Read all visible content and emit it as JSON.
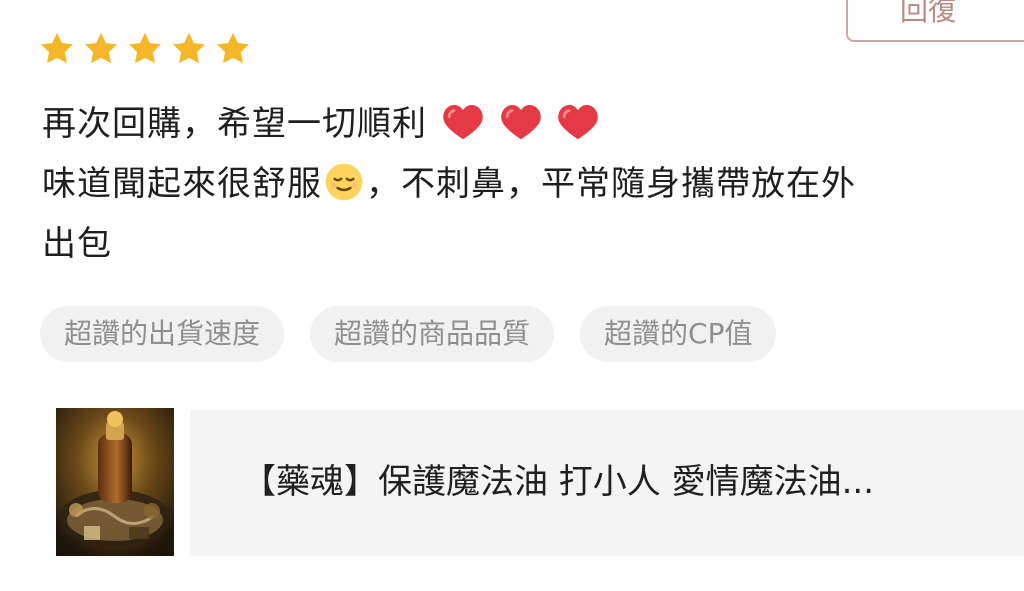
{
  "review": {
    "reply_label": "回復",
    "rating": 5,
    "lines": [
      "再次回購，希望一切順利",
      "味道聞起來很舒服",
      "，不刺鼻，平常隨身攜帶放在外",
      "出包"
    ]
  },
  "tags": [
    {
      "label": "超讚的出貨速度"
    },
    {
      "label": "超讚的商品品質"
    },
    {
      "label": "超讚的CP值"
    }
  ],
  "product": {
    "name": "【藥魂】保護魔法油 打小人 愛情魔法油",
    "ellipsis": "..."
  },
  "colors": {
    "star": "#f5b72a",
    "heart": "#e63946",
    "tag_background": "#f1f1f1",
    "tag_text": "#8f8f8f",
    "product_background": "#f4f4f4"
  },
  "icons": {
    "star": "star-icon",
    "heart": "heart-icon",
    "relieved_face": "relieved-face-icon",
    "product_image": "product-image"
  }
}
